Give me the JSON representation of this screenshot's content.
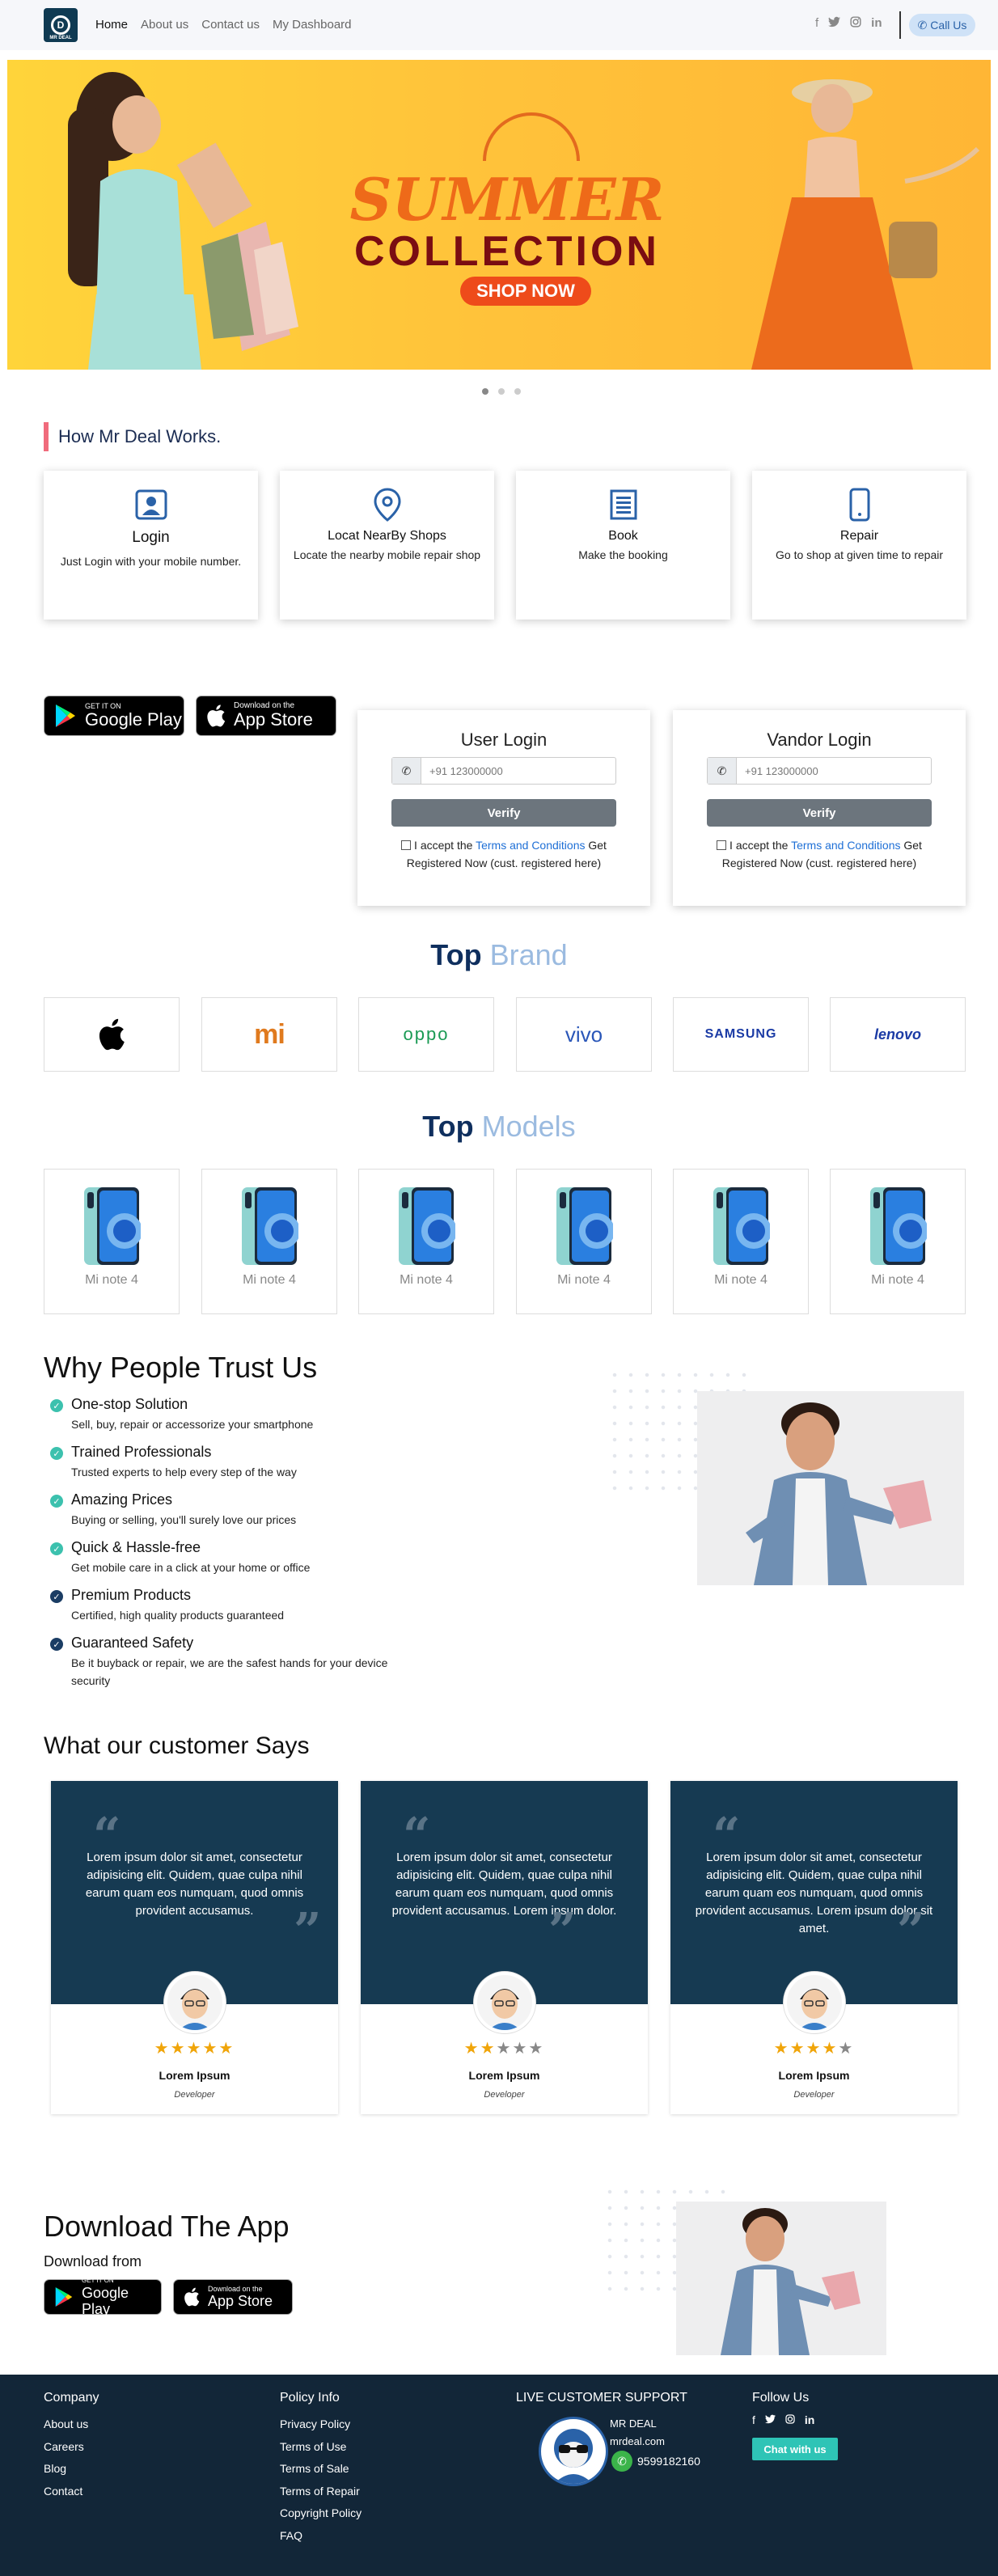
{
  "nav": {
    "logo_text": "MR DEAL",
    "menu": [
      "Home",
      "About us",
      "Contact us",
      "My Dashboard"
    ],
    "call_label": "Call Us",
    "social_icons": [
      "facebook-icon",
      "twitter-icon",
      "instagram-icon",
      "linkedin-icon"
    ]
  },
  "hero": {
    "title_line1": "SUMMER",
    "title_line2": "COLLECTION",
    "cta": "SHOP NOW",
    "slides": 3,
    "active_slide": 1
  },
  "how": {
    "title": "How Mr Deal Works.",
    "steps": [
      {
        "title": "Login",
        "desc": "Just Login with your mobile number.",
        "icon": "user-badge-icon"
      },
      {
        "title": "Locat NearBy Shops",
        "desc": "Locate the nearby mobile repair shop",
        "icon": "map-pin-icon"
      },
      {
        "title": "Book",
        "desc": "Make the booking",
        "icon": "clipboard-icon"
      },
      {
        "title": "Repair",
        "desc": "Go to shop at given time to repair",
        "icon": "mobile-icon"
      }
    ]
  },
  "stores": {
    "google_small": "GET IT ON",
    "google_big": "Google Play",
    "apple_small": "Download on the",
    "apple_big": "App Store"
  },
  "user_login": {
    "title": "User Login",
    "placeholder": "+91 123000000",
    "button": "Verify",
    "accept": "I accept the",
    "terms_link": "Terms and Conditions",
    "after": "Get Registered Now (cust. registered here)"
  },
  "vendor_login": {
    "title": "Vandor Login",
    "placeholder": "+91 123000000",
    "button": "Verify",
    "accept": "I accept the",
    "terms_link": "Terms and Conditions",
    "after": "Get Registered Now (cust. registered here)"
  },
  "brands": {
    "title_dark": "Top",
    "title_light": "Brand",
    "items": [
      "",
      "mi",
      "oppo",
      "vivo",
      "SAMSUNG",
      "lenovo"
    ]
  },
  "models": {
    "title_dark": "Top",
    "title_light": "Models",
    "items": [
      "Mi note 4",
      "Mi note 4",
      "Mi note 4",
      "Mi note 4",
      "Mi note 4",
      "Mi note 4"
    ]
  },
  "trust": {
    "title": "Why People Trust Us",
    "items": [
      {
        "title": "One-stop Solution",
        "desc": "Sell, buy, repair or accessorize your smartphone"
      },
      {
        "title": "Trained Professionals",
        "desc": "Trusted experts to help every step of the way"
      },
      {
        "title": "Amazing Prices",
        "desc": "Buying or selling, you'll surely love our prices"
      },
      {
        "title": "Quick & Hassle-free",
        "desc": "Get mobile care in a click at your home or office"
      },
      {
        "title": "Premium Products",
        "desc": "Certified, high quality products guaranteed"
      },
      {
        "title": "Guaranteed Safety",
        "desc": "Be it buyback or repair, we are the safest hands for your device security"
      }
    ]
  },
  "testimonials": {
    "title": "What our customer Says",
    "items": [
      {
        "text": "Lorem ipsum dolor sit amet, consectetur adipisicing elit. Quidem, quae culpa nihil earum quam eos numquam, quod omnis provident accusamus.",
        "name": "Lorem Ipsum",
        "role": "Developer",
        "rating": 5
      },
      {
        "text": "Lorem ipsum dolor sit amet, consectetur adipisicing elit. Quidem, quae culpa nihil earum quam eos numquam, quod omnis provident accusamus. Lorem ipsum dolor.",
        "name": "Lorem Ipsum",
        "role": "Developer",
        "rating": 2
      },
      {
        "text": "Lorem ipsum dolor sit amet, consectetur adipisicing elit. Quidem, quae culpa nihil earum quam eos numquam, quod omnis provident accusamus. Lorem ipsum dolor sit amet.",
        "name": "Lorem Ipsum",
        "role": "Developer",
        "rating": 4
      }
    ]
  },
  "download": {
    "title": "Download The App",
    "subtitle": "Download from"
  },
  "footer": {
    "company": {
      "title": "Company",
      "links": [
        "About us",
        "Careers",
        "Blog",
        "Contact"
      ]
    },
    "policy": {
      "title": "Policy Info",
      "links": [
        "Privacy Policy",
        "Terms of Use",
        "Terms of Sale",
        "Terms of Repair",
        "Copyright Policy",
        "FAQ"
      ]
    },
    "support": {
      "title": "LIVE CUSTOMER SUPPORT",
      "name": "MR DEAL",
      "site": "mrdeal.com",
      "phone": "9599182160"
    },
    "follow": {
      "title": "Follow Us",
      "chat": "Chat with us"
    }
  },
  "colors": {
    "primary": "#0f3a52",
    "accent": "#2a62a8",
    "star": "#f0a50a",
    "teal": "#2ec4b6"
  }
}
